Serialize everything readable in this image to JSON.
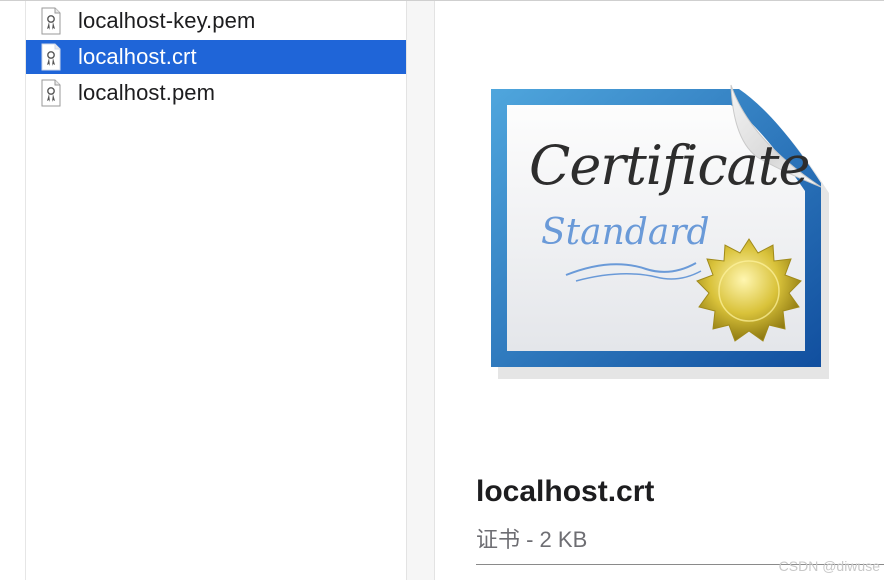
{
  "file_list": {
    "items": [
      {
        "name": "localhost-key.pem",
        "icon": "certificate-file-icon",
        "selected": false
      },
      {
        "name": "localhost.crt",
        "icon": "certificate-file-icon",
        "selected": true
      },
      {
        "name": "localhost.pem",
        "icon": "certificate-file-icon",
        "selected": false
      }
    ]
  },
  "preview": {
    "icon": "certificate-document-icon",
    "artwork_text": {
      "heading": "Certificate",
      "subheading": "Standard"
    },
    "title": "localhost.crt",
    "subtitle": "证书 - 2 KB"
  },
  "watermark": "CSDN @diwuse",
  "colors": {
    "selection": "#1f65d8",
    "certificate_border": "#1a63b5",
    "seal": "#d9c23a"
  }
}
